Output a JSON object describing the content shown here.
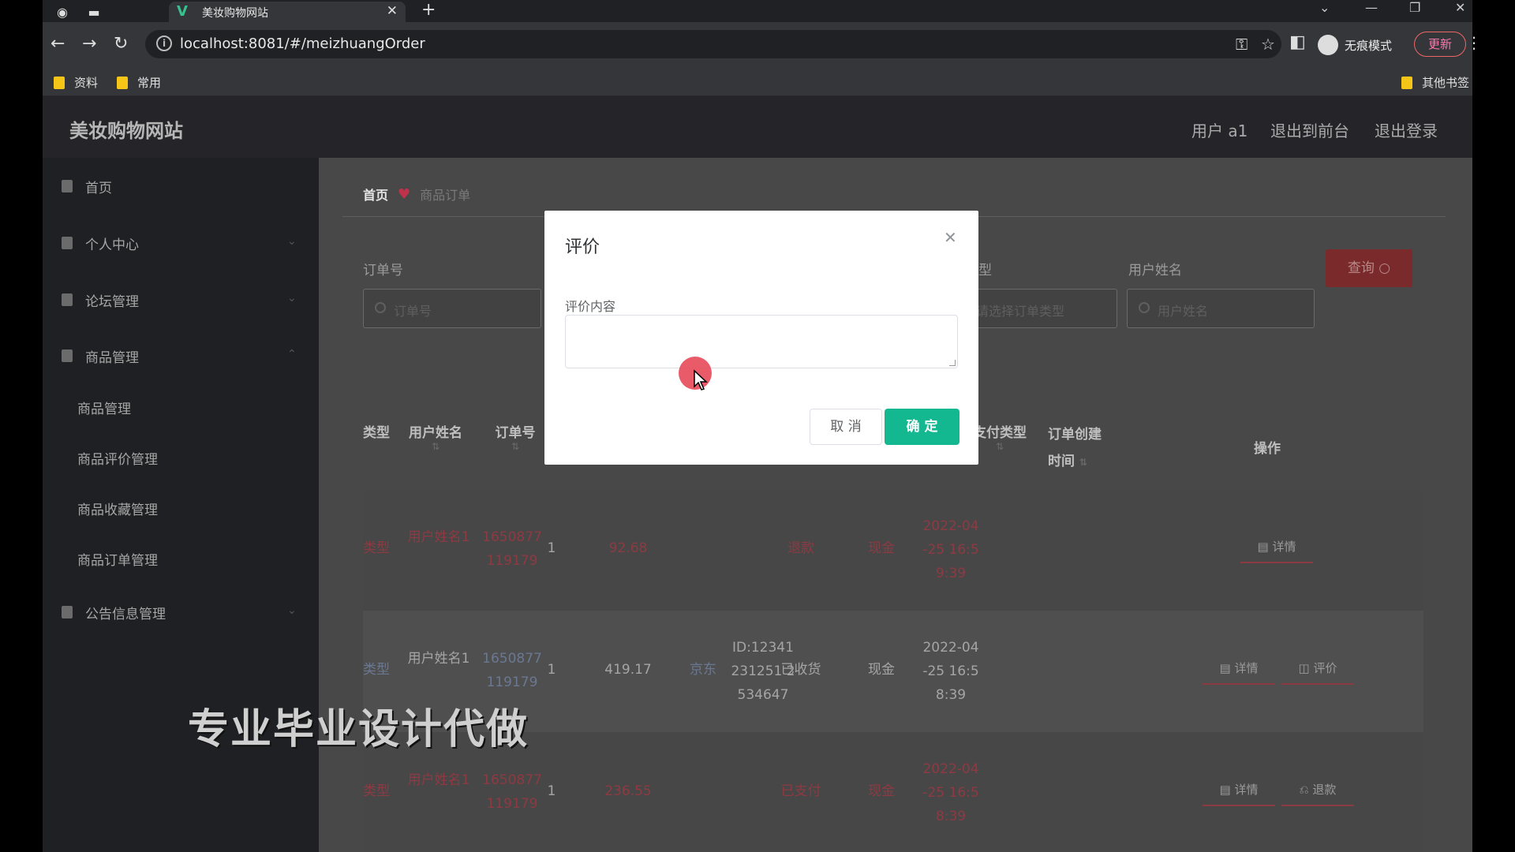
{
  "browser": {
    "tab_title": "美妆购物网站",
    "url": "localhost:8081/#/meizhuangOrder",
    "incognito_label": "无痕模式",
    "update_label": "更新",
    "bookmarks": [
      "资料",
      "常用"
    ],
    "other_bookmarks": "其他书签"
  },
  "header": {
    "logo": "美妆购物网站",
    "user": "用户 a1",
    "to_front": "退出到前台",
    "logout": "退出登录"
  },
  "sidebar": {
    "items": [
      {
        "label": "首页"
      },
      {
        "label": "个人中心"
      },
      {
        "label": "论坛管理"
      },
      {
        "label": "商品管理"
      }
    ],
    "subitems": [
      "商品管理",
      "商品评价管理",
      "商品收藏管理",
      "商品订单管理"
    ],
    "last_item": "公告信息管理"
  },
  "breadcrumb": {
    "home": "首页",
    "current": "商品订单"
  },
  "filters": {
    "order_no_label": "订单号",
    "order_no_placeholder": "订单号",
    "type_label": "型",
    "type_placeholder": "请选择订单类型",
    "username_label": "用户姓名",
    "username_placeholder": "用户姓名",
    "query_label": "查询"
  },
  "table": {
    "headers": {
      "type": "类型",
      "username": "用户姓名",
      "order_no": "订单号",
      "pay_type": "支付类型",
      "created_1": "订单创建",
      "created_2": "时间",
      "ops": "操作"
    },
    "rows": [
      {
        "type": "类型",
        "username": "用户姓名1",
        "order_no": "1650877119179",
        "qty": "1",
        "price": "92.68",
        "status": "退款",
        "pay": "现金",
        "time": "2022-04-25 16:59:39",
        "ops": [
          "详情"
        ]
      },
      {
        "type": "类型",
        "username": "用户姓名1",
        "order_no": "1650877119179",
        "qty": "1",
        "price": "419.17",
        "express": "京东",
        "express_no": "ID:12341231251 2534647",
        "status": "已收货",
        "pay": "现金",
        "time": "2022-04-25 16:58:39",
        "ops": [
          "详情",
          "评价"
        ]
      },
      {
        "type": "类型",
        "username": "用户姓名1",
        "order_no": "1650877119179",
        "qty": "1",
        "price": "236.55",
        "status": "已支付",
        "pay": "现金",
        "time": "2022-04-25 16:58:39",
        "ops": [
          "详情",
          "退款"
        ]
      }
    ]
  },
  "dialog": {
    "title": "评价",
    "field_label": "评价内容",
    "cancel": "取 消",
    "ok": "确 定"
  },
  "watermark": "专业毕业设计代做",
  "icons": {
    "chrome_logo": "chrome-icon",
    "heart": "heart-icon",
    "close": "close-icon"
  },
  "colors": {
    "accent_green": "#14b890",
    "accent_red": "#c0314a"
  }
}
